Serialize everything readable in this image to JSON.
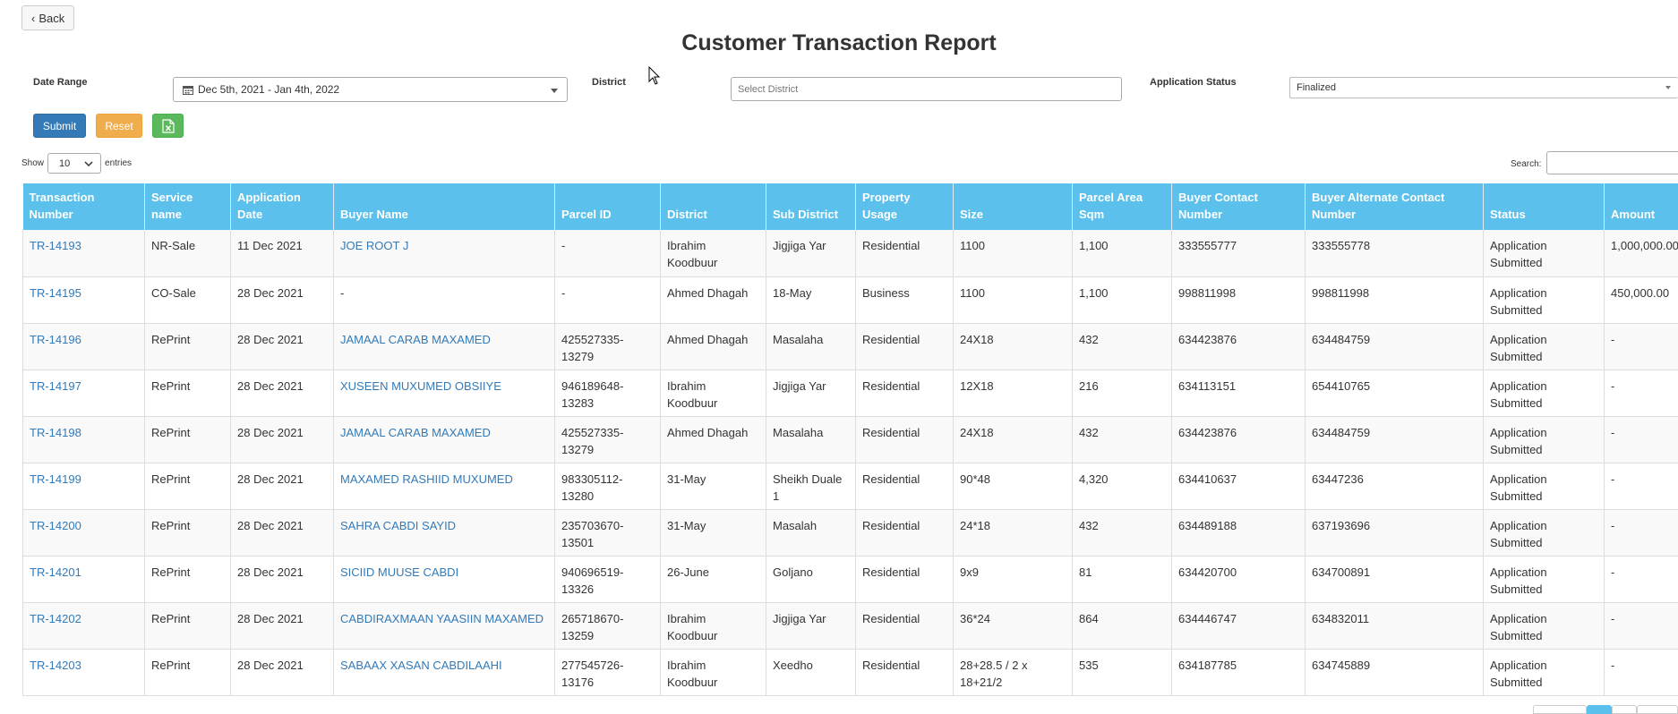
{
  "back_button": {
    "label": "Back",
    "icon": "chevron-left-icon"
  },
  "page_title": "Customer Transaction Report",
  "filters": {
    "date_range": {
      "label": "Date Range",
      "value": "Dec 5th, 2021 - Jan 4th, 2022",
      "icon": "calendar-icon"
    },
    "district": {
      "label": "District",
      "placeholder": "Select District"
    },
    "application_status": {
      "label": "Application Status",
      "value": "Finalized"
    }
  },
  "actions": {
    "submit_label": "Submit",
    "reset_label": "Reset",
    "export_icon": "excel-icon"
  },
  "table_controls": {
    "show_label": "Show",
    "entries_value": "10",
    "entries_label": "entries",
    "search_label": "Search:"
  },
  "table": {
    "columns": [
      "Transaction Number",
      "Service name",
      "Application Date",
      "Buyer Name",
      "Parcel ID",
      "District",
      "Sub District",
      "Property Usage",
      "Size",
      "Parcel Area Sqm",
      "Buyer Contact Number",
      "Buyer Alternate Contact Number",
      "Status",
      "Amount"
    ],
    "rows": [
      [
        "TR-14193",
        "NR-Sale",
        "11 Dec 2021",
        "JOE ROOT J",
        "-",
        "Ibrahim Koodbuur",
        "Jigjiga Yar",
        "Residential",
        "1100",
        "1,100",
        "333555777",
        "333555778",
        "Application Submitted",
        "1,000,000.00"
      ],
      [
        "TR-14195",
        "CO-Sale",
        "28 Dec 2021",
        "-",
        "-",
        "Ahmed Dhagah",
        "18-May",
        "Business",
        "1100",
        "1,100",
        "998811998",
        "998811998",
        "Application Submitted",
        "450,000.00"
      ],
      [
        "TR-14196",
        "RePrint",
        "28 Dec 2021",
        "JAMAAL CARAB MAXAMED",
        "425527335-13279",
        "Ahmed Dhagah",
        "Masalaha",
        "Residential",
        "24X18",
        "432",
        "634423876",
        "634484759",
        "Application Submitted",
        "-"
      ],
      [
        "TR-14197",
        "RePrint",
        "28 Dec 2021",
        "XUSEEN MUXUMED OBSIIYE",
        "946189648-13283",
        "Ibrahim Koodbuur",
        "Jigjiga Yar",
        "Residential",
        "12X18",
        "216",
        "634113151",
        "654410765",
        "Application Submitted",
        "-"
      ],
      [
        "TR-14198",
        "RePrint",
        "28 Dec 2021",
        "JAMAAL CARAB MAXAMED",
        "425527335-13279",
        "Ahmed Dhagah",
        "Masalaha",
        "Residential",
        "24X18",
        "432",
        "634423876",
        "634484759",
        "Application Submitted",
        "-"
      ],
      [
        "TR-14199",
        "RePrint",
        "28 Dec 2021",
        "MAXAMED RASHIID MUXUMED",
        "983305112-13280",
        "31-May",
        "Sheikh Duale 1",
        "Residential",
        "90*48",
        "4,320",
        "634410637",
        "63447236",
        "Application Submitted",
        "-"
      ],
      [
        "TR-14200",
        "RePrint",
        "28 Dec 2021",
        "SAHRA CABDI SAYID",
        "235703670-13501",
        "31-May",
        "Masalah",
        "Residential",
        "24*18",
        "432",
        "634489188",
        "637193696",
        "Application Submitted",
        "-"
      ],
      [
        "TR-14201",
        "RePrint",
        "28 Dec 2021",
        "SICIID MUUSE CABDI",
        "940696519-13326",
        "26-June",
        "Goljano",
        "Residential",
        "9x9",
        "81",
        "634420700",
        "634700891",
        "Application Submitted",
        "-"
      ],
      [
        "TR-14202",
        "RePrint",
        "28 Dec 2021",
        "CABDIRAXMAAN YAASIIN MAXAMED",
        "265718670-13259",
        "Ibrahim Koodbuur",
        "Jigjiga Yar",
        "Residential",
        "36*24",
        "864",
        "634446747",
        "634832011",
        "Application Submitted",
        "-"
      ],
      [
        "TR-14203",
        "RePrint",
        "28 Dec 2021",
        "SABAAX XASAN CABDILAAHI",
        "277545726-13176",
        "Ibrahim Koodbuur",
        "Xeedho",
        "Residential",
        "28+28.5 / 2 x 18+21/2",
        "535",
        "634187785",
        "634745889",
        "Application Submitted",
        "-"
      ]
    ]
  },
  "colors": {
    "header_bg": "#5bc0eb",
    "link": "#337ab7",
    "submit": "#337ab7",
    "reset": "#f0ad4e",
    "export": "#5cb85c",
    "pager_active": "#5bc0eb"
  }
}
